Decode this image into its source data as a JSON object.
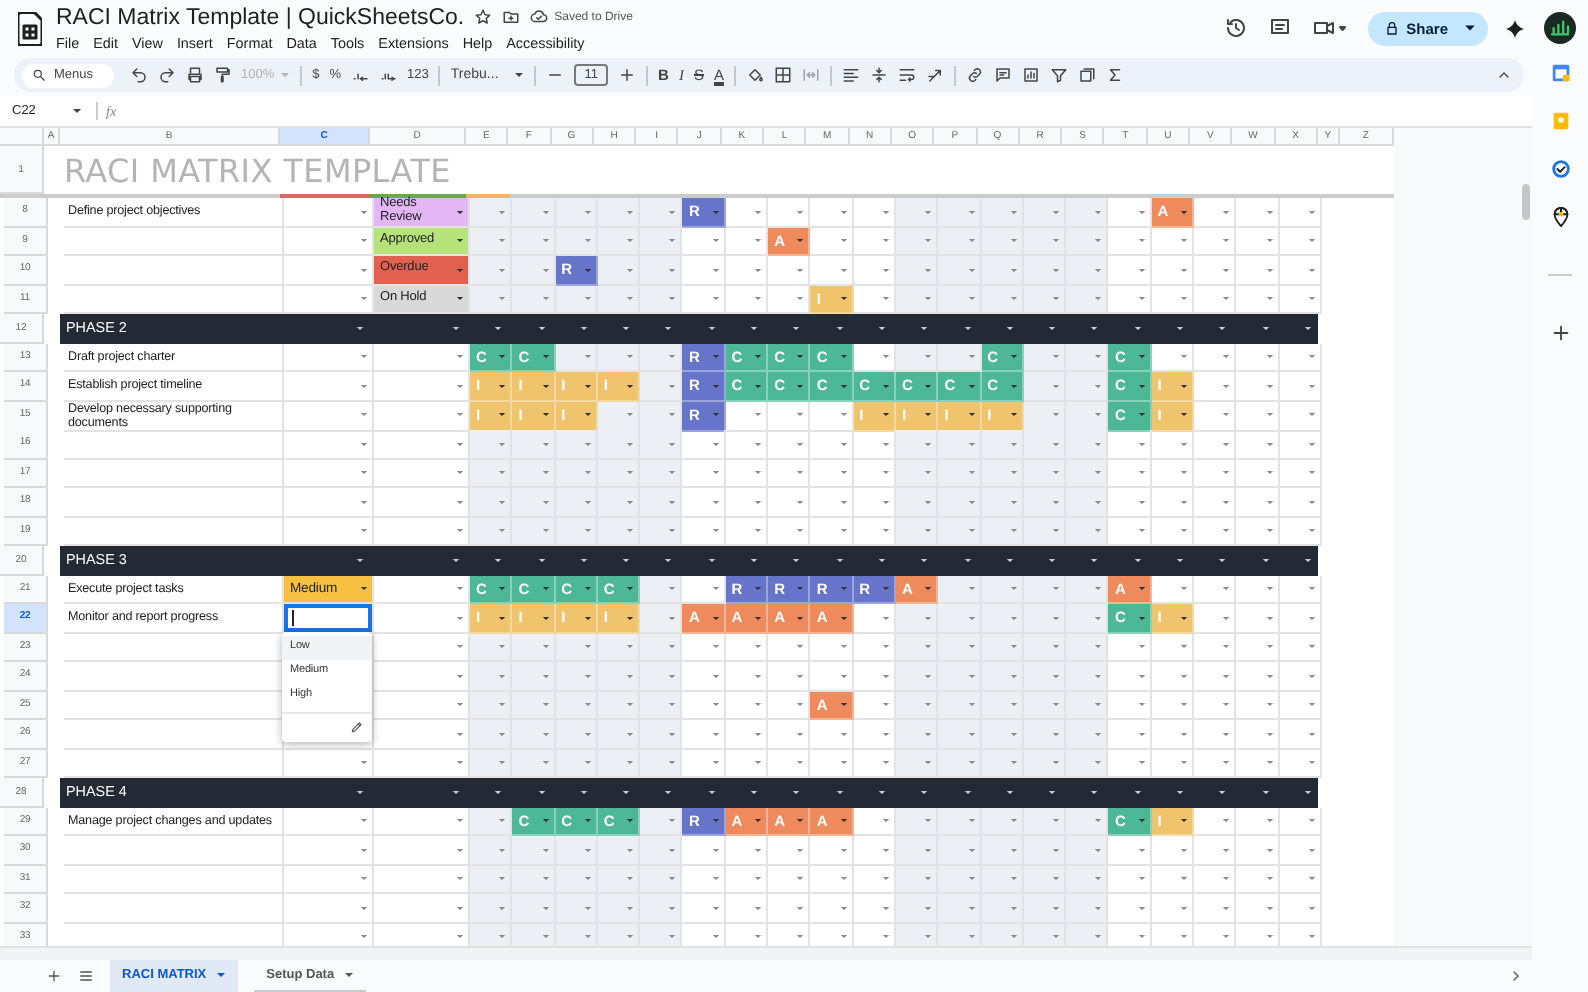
{
  "app": {
    "title": "RACI Matrix Template | QuickSheetsCo.",
    "save_status": "Saved to Drive",
    "share": "Share"
  },
  "menu": [
    "File",
    "Edit",
    "View",
    "Insert",
    "Format",
    "Data",
    "Tools",
    "Extensions",
    "Help",
    "Accessibility"
  ],
  "toolbar": {
    "search": "Menus",
    "zoom": {
      "label": "100%",
      "disabled": true
    },
    "currency": "$",
    "percent": "%",
    "number_format": "123",
    "font": "Trebu...",
    "font_size": "11",
    "bold": "B",
    "italic": "I",
    "strike": "S",
    "text_color": "A"
  },
  "formula_bar": {
    "cell": "C22",
    "fx": "fx"
  },
  "columns": [
    {
      "label": "A",
      "selected": false
    },
    {
      "label": "B",
      "selected": false
    },
    {
      "label": "C",
      "selected": true
    },
    {
      "label": "D",
      "selected": false
    },
    {
      "label": "E",
      "selected": false
    },
    {
      "label": "F",
      "selected": false
    },
    {
      "label": "G",
      "selected": false
    },
    {
      "label": "H",
      "selected": false
    },
    {
      "label": "I",
      "selected": false
    },
    {
      "label": "J",
      "selected": false
    },
    {
      "label": "K",
      "selected": false
    },
    {
      "label": "L",
      "selected": false
    },
    {
      "label": "M",
      "selected": false
    },
    {
      "label": "N",
      "selected": false
    },
    {
      "label": "O",
      "selected": false
    },
    {
      "label": "P",
      "selected": false
    },
    {
      "label": "Q",
      "selected": false
    },
    {
      "label": "R",
      "selected": false
    },
    {
      "label": "S",
      "selected": false
    },
    {
      "label": "T",
      "selected": false
    },
    {
      "label": "U",
      "selected": false
    },
    {
      "label": "V",
      "selected": false
    },
    {
      "label": "W",
      "selected": false
    },
    {
      "label": "X",
      "selected": false
    },
    {
      "label": "Y",
      "selected": false
    },
    {
      "label": "Z",
      "selected": false
    }
  ],
  "title_row": {
    "number": "1",
    "text": "RACI MATRIX TEMPLATE"
  },
  "rows": [
    {
      "number": "8",
      "kind": "task",
      "selected": false,
      "task": "Define project objectives",
      "status": {
        "text": "Needs Review",
        "color": "#e3b7f5"
      },
      "roles": [
        {
          "filled": false
        },
        {
          "filled": false
        },
        {
          "filled": false
        },
        {
          "filled": false
        },
        {
          "filled": false
        },
        {
          "filled": true,
          "role": "R",
          "color": "#6674c9"
        },
        {
          "filled": false
        },
        {
          "filled": false
        },
        {
          "filled": false
        },
        {
          "filled": false
        },
        {
          "filled": false
        },
        {
          "filled": false
        },
        {
          "filled": false
        },
        {
          "filled": false
        },
        {
          "filled": false
        },
        {
          "filled": false
        },
        {
          "filled": true,
          "role": "A",
          "color": "#ee8a5b"
        },
        {
          "filled": false
        },
        {
          "filled": false
        },
        {
          "filled": false
        }
      ]
    },
    {
      "number": "9",
      "kind": "task",
      "selected": false,
      "status": {
        "text": "Approved",
        "color": "#b5e37a"
      },
      "roles": [
        {
          "filled": false
        },
        {
          "filled": false
        },
        {
          "filled": false
        },
        {
          "filled": false
        },
        {
          "filled": false
        },
        {
          "filled": false
        },
        {
          "filled": false
        },
        {
          "filled": true,
          "role": "A",
          "color": "#ee8a5b"
        },
        {
          "filled": false
        },
        {
          "filled": false
        },
        {
          "filled": false
        },
        {
          "filled": false
        },
        {
          "filled": false
        },
        {
          "filled": false
        },
        {
          "filled": false
        },
        {
          "filled": false
        },
        {
          "filled": false
        },
        {
          "filled": false
        },
        {
          "filled": false
        },
        {
          "filled": false
        }
      ]
    },
    {
      "number": "10",
      "kind": "task",
      "selected": false,
      "status": {
        "text": "Overdue",
        "color": "#e2604f"
      },
      "roles": [
        {
          "filled": false
        },
        {
          "filled": false
        },
        {
          "filled": true,
          "role": "R",
          "color": "#6674c9"
        },
        {
          "filled": false
        },
        {
          "filled": false
        },
        {
          "filled": false
        },
        {
          "filled": false
        },
        {
          "filled": false
        },
        {
          "filled": false
        },
        {
          "filled": false
        },
        {
          "filled": false
        },
        {
          "filled": false
        },
        {
          "filled": false
        },
        {
          "filled": false
        },
        {
          "filled": false
        },
        {
          "filled": false
        },
        {
          "filled": false
        },
        {
          "filled": false
        },
        {
          "filled": false
        },
        {
          "filled": false
        }
      ]
    },
    {
      "number": "11",
      "kind": "task",
      "selected": false,
      "status": {
        "text": "On Hold",
        "color": "#d9d9d9"
      },
      "roles": [
        {
          "filled": false
        },
        {
          "filled": false
        },
        {
          "filled": false
        },
        {
          "filled": false
        },
        {
          "filled": false
        },
        {
          "filled": false
        },
        {
          "filled": false
        },
        {
          "filled": false
        },
        {
          "filled": true,
          "role": "I",
          "color": "#f0c36d"
        },
        {
          "filled": false
        },
        {
          "filled": false
        },
        {
          "filled": false
        },
        {
          "filled": false
        },
        {
          "filled": false
        },
        {
          "filled": false
        },
        {
          "filled": false
        },
        {
          "filled": false
        },
        {
          "filled": false
        },
        {
          "filled": false
        },
        {
          "filled": false
        }
      ]
    },
    {
      "number": "12",
      "kind": "phase",
      "selected": false,
      "label": "PHASE 2"
    },
    {
      "number": "13",
      "kind": "task",
      "selected": false,
      "task": "Draft project charter",
      "roles": [
        {
          "filled": true,
          "role": "C",
          "color": "#4cb895"
        },
        {
          "filled": true,
          "role": "C",
          "color": "#4cb895"
        },
        {
          "filled": false
        },
        {
          "filled": false
        },
        {
          "filled": false
        },
        {
          "filled": true,
          "role": "R",
          "color": "#6674c9"
        },
        {
          "filled": true,
          "role": "C",
          "color": "#4cb895"
        },
        {
          "filled": true,
          "role": "C",
          "color": "#4cb895"
        },
        {
          "filled": true,
          "role": "C",
          "color": "#4cb895"
        },
        {
          "filled": false
        },
        {
          "filled": false
        },
        {
          "filled": false
        },
        {
          "filled": true,
          "role": "C",
          "color": "#4cb895"
        },
        {
          "filled": false
        },
        {
          "filled": false
        },
        {
          "filled": true,
          "role": "C",
          "color": "#4cb895"
        },
        {
          "filled": false
        },
        {
          "filled": false
        },
        {
          "filled": false
        },
        {
          "filled": false
        }
      ]
    },
    {
      "number": "14",
      "kind": "task",
      "selected": false,
      "task": "Establish project timeline",
      "roles": [
        {
          "filled": true,
          "role": "I",
          "color": "#f0c36d"
        },
        {
          "filled": true,
          "role": "I",
          "color": "#f0c36d"
        },
        {
          "filled": true,
          "role": "I",
          "color": "#f0c36d"
        },
        {
          "filled": true,
          "role": "I",
          "color": "#f0c36d"
        },
        {
          "filled": false
        },
        {
          "filled": true,
          "role": "R",
          "color": "#6674c9"
        },
        {
          "filled": true,
          "role": "C",
          "color": "#4cb895"
        },
        {
          "filled": true,
          "role": "C",
          "color": "#4cb895"
        },
        {
          "filled": true,
          "role": "C",
          "color": "#4cb895"
        },
        {
          "filled": true,
          "role": "C",
          "color": "#4cb895"
        },
        {
          "filled": true,
          "role": "C",
          "color": "#4cb895"
        },
        {
          "filled": true,
          "role": "C",
          "color": "#4cb895"
        },
        {
          "filled": true,
          "role": "C",
          "color": "#4cb895"
        },
        {
          "filled": false
        },
        {
          "filled": false
        },
        {
          "filled": true,
          "role": "C",
          "color": "#4cb895"
        },
        {
          "filled": true,
          "role": "I",
          "color": "#f0c36d"
        },
        {
          "filled": false
        },
        {
          "filled": false
        },
        {
          "filled": false
        }
      ]
    },
    {
      "number": "15",
      "kind": "task",
      "selected": false,
      "task": "Develop necessary supporting documents",
      "roles": [
        {
          "filled": true,
          "role": "I",
          "color": "#f0c36d"
        },
        {
          "filled": true,
          "role": "I",
          "color": "#f0c36d"
        },
        {
          "filled": true,
          "role": "I",
          "color": "#f0c36d"
        },
        {
          "filled": false
        },
        {
          "filled": false
        },
        {
          "filled": true,
          "role": "R",
          "color": "#6674c9"
        },
        {
          "filled": false
        },
        {
          "filled": false
        },
        {
          "filled": false
        },
        {
          "filled": true,
          "role": "I",
          "color": "#f0c36d"
        },
        {
          "filled": true,
          "role": "I",
          "color": "#f0c36d"
        },
        {
          "filled": true,
          "role": "I",
          "color": "#f0c36d"
        },
        {
          "filled": true,
          "role": "I",
          "color": "#f0c36d"
        },
        {
          "filled": false
        },
        {
          "filled": false
        },
        {
          "filled": true,
          "role": "C",
          "color": "#4cb895"
        },
        {
          "filled": true,
          "role": "I",
          "color": "#f0c36d"
        },
        {
          "filled": false
        },
        {
          "filled": false
        },
        {
          "filled": false
        }
      ]
    },
    {
      "number": "16",
      "kind": "task",
      "selected": false
    },
    {
      "number": "17",
      "kind": "task",
      "selected": false
    },
    {
      "number": "18",
      "kind": "task",
      "selected": false
    },
    {
      "number": "19",
      "kind": "task",
      "selected": false
    },
    {
      "number": "20",
      "kind": "phase",
      "selected": false,
      "label": "PHASE 3"
    },
    {
      "number": "21",
      "kind": "task",
      "selected": false,
      "task": "Execute project tasks",
      "priority": {
        "text": "Medium",
        "color": "#f6c143"
      },
      "roles": [
        {
          "filled": true,
          "role": "C",
          "color": "#4cb895"
        },
        {
          "filled": true,
          "role": "C",
          "color": "#4cb895"
        },
        {
          "filled": true,
          "role": "C",
          "color": "#4cb895"
        },
        {
          "filled": true,
          "role": "C",
          "color": "#4cb895"
        },
        {
          "filled": false
        },
        {
          "filled": false
        },
        {
          "filled": true,
          "role": "R",
          "color": "#6674c9"
        },
        {
          "filled": true,
          "role": "R",
          "color": "#6674c9"
        },
        {
          "filled": true,
          "role": "R",
          "color": "#6674c9"
        },
        {
          "filled": true,
          "role": "R",
          "color": "#6674c9"
        },
        {
          "filled": true,
          "role": "A",
          "color": "#ee8a5b"
        },
        {
          "filled": false
        },
        {
          "filled": false
        },
        {
          "filled": false
        },
        {
          "filled": false
        },
        {
          "filled": true,
          "role": "A",
          "color": "#ee8a5b"
        },
        {
          "filled": false
        },
        {
          "filled": false
        },
        {
          "filled": false
        },
        {
          "filled": false
        }
      ]
    },
    {
      "number": "22",
      "kind": "task",
      "selected": true,
      "task": "Monitor and report progress",
      "priority_menu": {
        "options": [
          {
            "label": "Low",
            "selected": true
          },
          {
            "label": "Medium",
            "selected": false
          },
          {
            "label": "High",
            "selected": false
          }
        ]
      },
      "roles": [
        {
          "filled": true,
          "role": "I",
          "color": "#f0c36d"
        },
        {
          "filled": true,
          "role": "I",
          "color": "#f0c36d"
        },
        {
          "filled": true,
          "role": "I",
          "color": "#f0c36d"
        },
        {
          "filled": true,
          "role": "I",
          "color": "#f0c36d"
        },
        {
          "filled": false
        },
        {
          "filled": true,
          "role": "A",
          "color": "#ee8a5b"
        },
        {
          "filled": true,
          "role": "A",
          "color": "#ee8a5b"
        },
        {
          "filled": true,
          "role": "A",
          "color": "#ee8a5b"
        },
        {
          "filled": true,
          "role": "A",
          "color": "#ee8a5b"
        },
        {
          "filled": false
        },
        {
          "filled": false
        },
        {
          "filled": false
        },
        {
          "filled": false
        },
        {
          "filled": false
        },
        {
          "filled": false
        },
        {
          "filled": true,
          "role": "C",
          "color": "#4cb895"
        },
        {
          "filled": true,
          "role": "I",
          "color": "#f0c36d"
        },
        {
          "filled": false
        },
        {
          "filled": false
        },
        {
          "filled": false
        }
      ]
    },
    {
      "number": "23",
      "kind": "task",
      "selected": false
    },
    {
      "number": "24",
      "kind": "task",
      "selected": false
    },
    {
      "number": "25",
      "kind": "task",
      "selected": false,
      "roles": [
        {
          "filled": false
        },
        {
          "filled": false
        },
        {
          "filled": false
        },
        {
          "filled": false
        },
        {
          "filled": false
        },
        {
          "filled": false
        },
        {
          "filled": false
        },
        {
          "filled": false
        },
        {
          "filled": true,
          "role": "A",
          "color": "#ee8a5b"
        },
        {
          "filled": false
        },
        {
          "filled": false
        },
        {
          "filled": false
        },
        {
          "filled": false
        },
        {
          "filled": false
        },
        {
          "filled": false
        },
        {
          "filled": false
        },
        {
          "filled": false
        },
        {
          "filled": false
        },
        {
          "filled": false
        },
        {
          "filled": false
        }
      ]
    },
    {
      "number": "26",
      "kind": "task",
      "selected": false
    },
    {
      "number": "27",
      "kind": "task",
      "selected": false
    },
    {
      "number": "28",
      "kind": "phase",
      "selected": false,
      "label": "PHASE 4"
    },
    {
      "number": "29",
      "kind": "task",
      "selected": false,
      "task": "Manage project changes and updates",
      "roles": [
        {
          "filled": false
        },
        {
          "filled": true,
          "role": "C",
          "color": "#4cb895"
        },
        {
          "filled": true,
          "role": "C",
          "color": "#4cb895"
        },
        {
          "filled": true,
          "role": "C",
          "color": "#4cb895"
        },
        {
          "filled": false
        },
        {
          "filled": true,
          "role": "R",
          "color": "#6674c9"
        },
        {
          "filled": true,
          "role": "A",
          "color": "#ee8a5b"
        },
        {
          "filled": true,
          "role": "A",
          "color": "#ee8a5b"
        },
        {
          "filled": true,
          "role": "A",
          "color": "#ee8a5b"
        },
        {
          "filled": false
        },
        {
          "filled": false
        },
        {
          "filled": false
        },
        {
          "filled": false
        },
        {
          "filled": false
        },
        {
          "filled": false
        },
        {
          "filled": true,
          "role": "C",
          "color": "#4cb895"
        },
        {
          "filled": true,
          "role": "I",
          "color": "#f0c36d"
        },
        {
          "filled": false
        },
        {
          "filled": false
        },
        {
          "filled": false
        }
      ]
    },
    {
      "number": "30",
      "kind": "task",
      "selected": false
    },
    {
      "number": "31",
      "kind": "task",
      "selected": false
    },
    {
      "number": "32",
      "kind": "task",
      "selected": false
    },
    {
      "number": "33",
      "kind": "task",
      "selected": false
    }
  ],
  "sheets": [
    {
      "label": "RACI MATRIX",
      "selected": true
    },
    {
      "label": "Setup Data",
      "selected": false
    }
  ]
}
